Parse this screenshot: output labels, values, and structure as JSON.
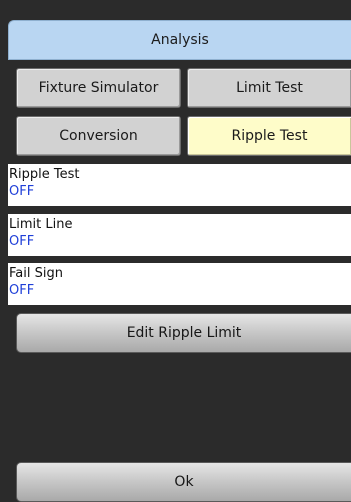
{
  "title": "Analysis",
  "buttons": {
    "fixture_simulator": "Fixture Simulator",
    "limit_test": "Limit Test",
    "conversion": "Conversion",
    "ripple_test": "Ripple Test"
  },
  "info": [
    {
      "label": "Ripple Test",
      "value": "OFF"
    },
    {
      "label": "Limit Line",
      "value": "OFF"
    },
    {
      "label": "Fail Sign",
      "value": "OFF"
    }
  ],
  "edit_ripple_limit": "Edit Ripple Limit",
  "ok": "Ok",
  "colors": {
    "title_bg": "#b9d6f2",
    "active_bg": "#fefcc9",
    "value_text": "#1f3fd8",
    "panel_bg": "#2b2b2b"
  }
}
